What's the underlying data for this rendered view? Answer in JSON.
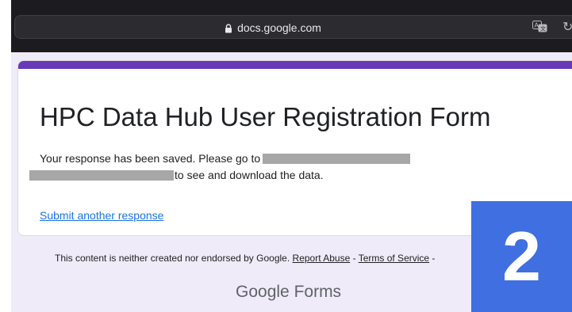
{
  "browser": {
    "url": "docs.google.com",
    "icons": {
      "lock": "lock-icon",
      "translate": "translate-icon",
      "reload": "reload-icon"
    }
  },
  "form": {
    "title": "HPC Data Hub User Registration Form",
    "confirmation_line1": "Your response has been saved. Please go to",
    "confirmation_line2_suffix": "to see and download the data.",
    "submit_another": "Submit another response",
    "accent_color": "#673ab7"
  },
  "footer": {
    "disclaimer": "This content is neither created nor endorsed by Google.",
    "report_abuse": "Report Abuse",
    "separator": "-",
    "terms": "Terms of Service",
    "brand_main": "Google",
    "brand_product": "Forms"
  },
  "badge": {
    "number": "2",
    "color": "#3f6fe0"
  }
}
